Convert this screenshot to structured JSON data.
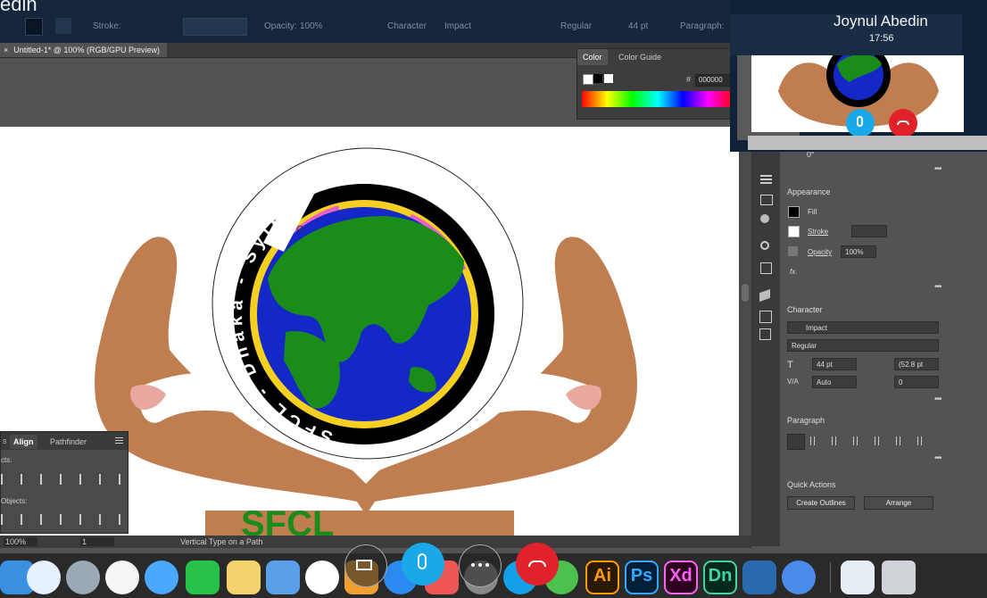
{
  "call": {
    "caller_name": "Joynul Abedin",
    "elapsed": "17:56"
  },
  "title_fragment": "edin",
  "control_bar": {
    "stroke_label": "Stroke:",
    "opacity_label": "Opacity:",
    "opacity_value": "100%",
    "character_label": "Character",
    "font_value": "Impact",
    "style_value": "Regular",
    "size_value": "44 pt",
    "paragraph_label": "Paragraph:"
  },
  "document": {
    "tab_title": "Untitled-1* @ 100% (RGB/GPU Preview)",
    "close_glyph": "×"
  },
  "color_panel": {
    "tab_color": "Color",
    "tab_color_guide": "Color Guide",
    "hash": "#",
    "hex_value": "000000"
  },
  "properties": {
    "angle_value": "0°",
    "appearance": {
      "title": "Appearance",
      "fill_label": "Fill",
      "stroke_label": "Stroke",
      "opacity_label": "Opacity",
      "opacity_value": "100%",
      "fx_label": "fx."
    },
    "character": {
      "title": "Character",
      "font": "Impact",
      "style": "Regular",
      "size": "44 pt",
      "leading": "(52.8 pt",
      "kerning": "Auto",
      "tracking": "0"
    },
    "paragraph": {
      "title": "Paragraph"
    },
    "quick_actions": {
      "title": "Quick Actions",
      "create_outlines": "Create Outlines",
      "arrange": "Arrange"
    }
  },
  "align_panel": {
    "tab_prev": "s",
    "tab_align": "Align",
    "tab_pathfinder": "Pathfinder",
    "label_objects": "cts:",
    "label_distribute": "Objects:"
  },
  "status_bar": {
    "zoom": "100%",
    "artboard_number": "1",
    "tool_name": "Vertical Type on a Path"
  },
  "artwork": {
    "circle_text": "SFCL - Dhaka - Sylhet",
    "bottom_text": "SFCL",
    "colors": {
      "hands": "#c07e50",
      "ocean": "#1428c8",
      "land": "#1a8c1a",
      "ring": "#000000",
      "ring_inner": "#f5d020",
      "accent_pink": "#e85fc8",
      "nails": "#e8a8a0"
    }
  },
  "dock": {
    "app_ai": "Ai",
    "app_ps": "Ps",
    "app_xd": "Xd",
    "app_dn": "Dn"
  },
  "colors": {
    "call_bg": "#0f2238",
    "mic_button": "#19a8e8",
    "hangup_button": "#e0222a"
  }
}
